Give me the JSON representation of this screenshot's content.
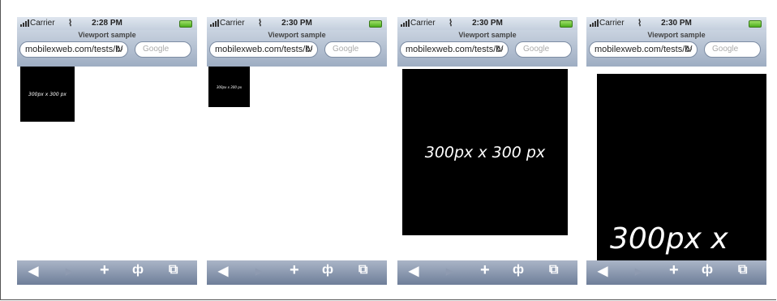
{
  "phones": [
    {
      "carrier": "Carrier",
      "time": "2:28 PM",
      "title": "Viewport sample",
      "url": "mobilexweb.com/tests/b/",
      "search_placeholder": "Google",
      "box_label": "300px x 300 px"
    },
    {
      "carrier": "Carrier",
      "time": "2:30 PM",
      "title": "Viewport sample",
      "url": "mobilexweb.com/tests/b/",
      "search_placeholder": "Google",
      "box_label": "300px x 300 px"
    },
    {
      "carrier": "Carrier",
      "time": "2:30 PM",
      "title": "Viewport sample",
      "url": "mobilexweb.com/tests/b/",
      "search_placeholder": "Google",
      "box_label": "300px x 300 px"
    },
    {
      "carrier": "Carrier",
      "time": "2:30 PM",
      "title": "Viewport sample",
      "url": "mobilexweb.com/tests/b/",
      "search_placeholder": "Google",
      "box_label": "300px x"
    }
  ],
  "icons": {
    "wifi": "⭘",
    "reload": "↻",
    "back": "◀",
    "forward": "▶",
    "add": "+",
    "bookmarks": "ф",
    "pages": "⧉"
  }
}
